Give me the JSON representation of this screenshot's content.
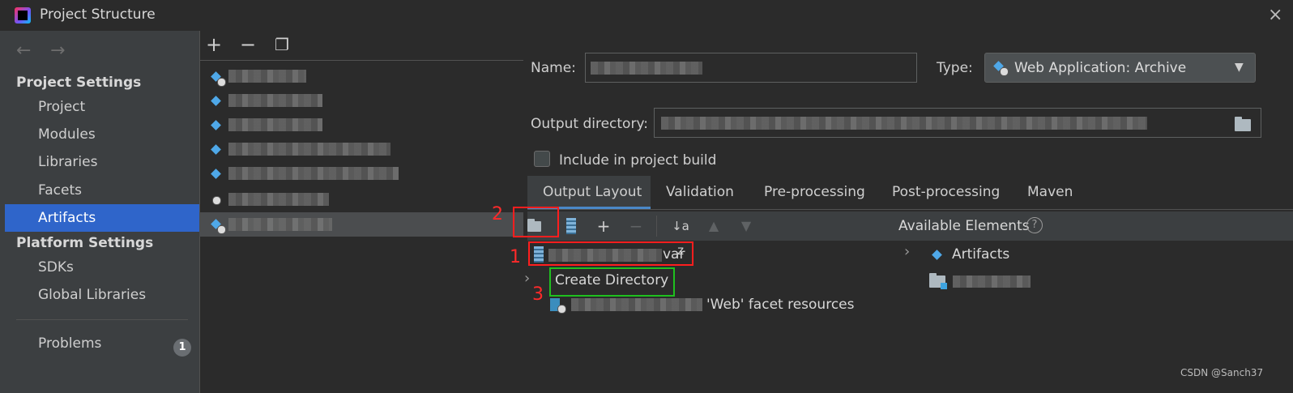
{
  "window": {
    "title": "Project Structure",
    "close_icon": "×"
  },
  "nav": {
    "back": "←",
    "forward": "→"
  },
  "sidebar": {
    "project_settings_header": "Project Settings",
    "project_items": [
      "Project",
      "Modules",
      "Libraries",
      "Facets",
      "Artifacts"
    ],
    "selected_item": "Artifacts",
    "platform_settings_header": "Platform Settings",
    "platform_items": [
      "SDKs",
      "Global Libraries"
    ],
    "problems_label": "Problems",
    "problems_count": "1"
  },
  "artifact_toolbar": {
    "add": "+",
    "remove": "−",
    "copy": "❐"
  },
  "artifact_list": {
    "count_visible": 7,
    "selected_index": 6
  },
  "form": {
    "name_label": "Name:",
    "type_label": "Type:",
    "type_value": "Web Application: Archive",
    "output_dir_label": "Output directory:",
    "include_build_label": "Include in project build",
    "include_build_checked": false
  },
  "tabs": [
    "Output Layout",
    "Validation",
    "Pre-processing",
    "Post-processing",
    "Maven"
  ],
  "active_tab": "Output Layout",
  "layout_toolbar": {
    "create_dir": "📁+",
    "add": "+",
    "remove": "−",
    "sort": "↓a z",
    "up": "▲",
    "down": "▼"
  },
  "output_tree": {
    "root_suffix": "var",
    "create_directory_label": "Create Directory",
    "facet_resources_suffix": "'Web' facet resources"
  },
  "available": {
    "header": "Available Elements",
    "help": "?",
    "artifacts_label": "Artifacts"
  },
  "annotations": {
    "one": "1",
    "two": "2",
    "three": "3"
  },
  "watermark": "CSDN @Sanch37",
  "colors": {
    "selection": "#2f65ca",
    "annotation_red": "#ff1e1e",
    "annotation_green": "#1fc01f",
    "tab_underline": "#4a88c7"
  }
}
